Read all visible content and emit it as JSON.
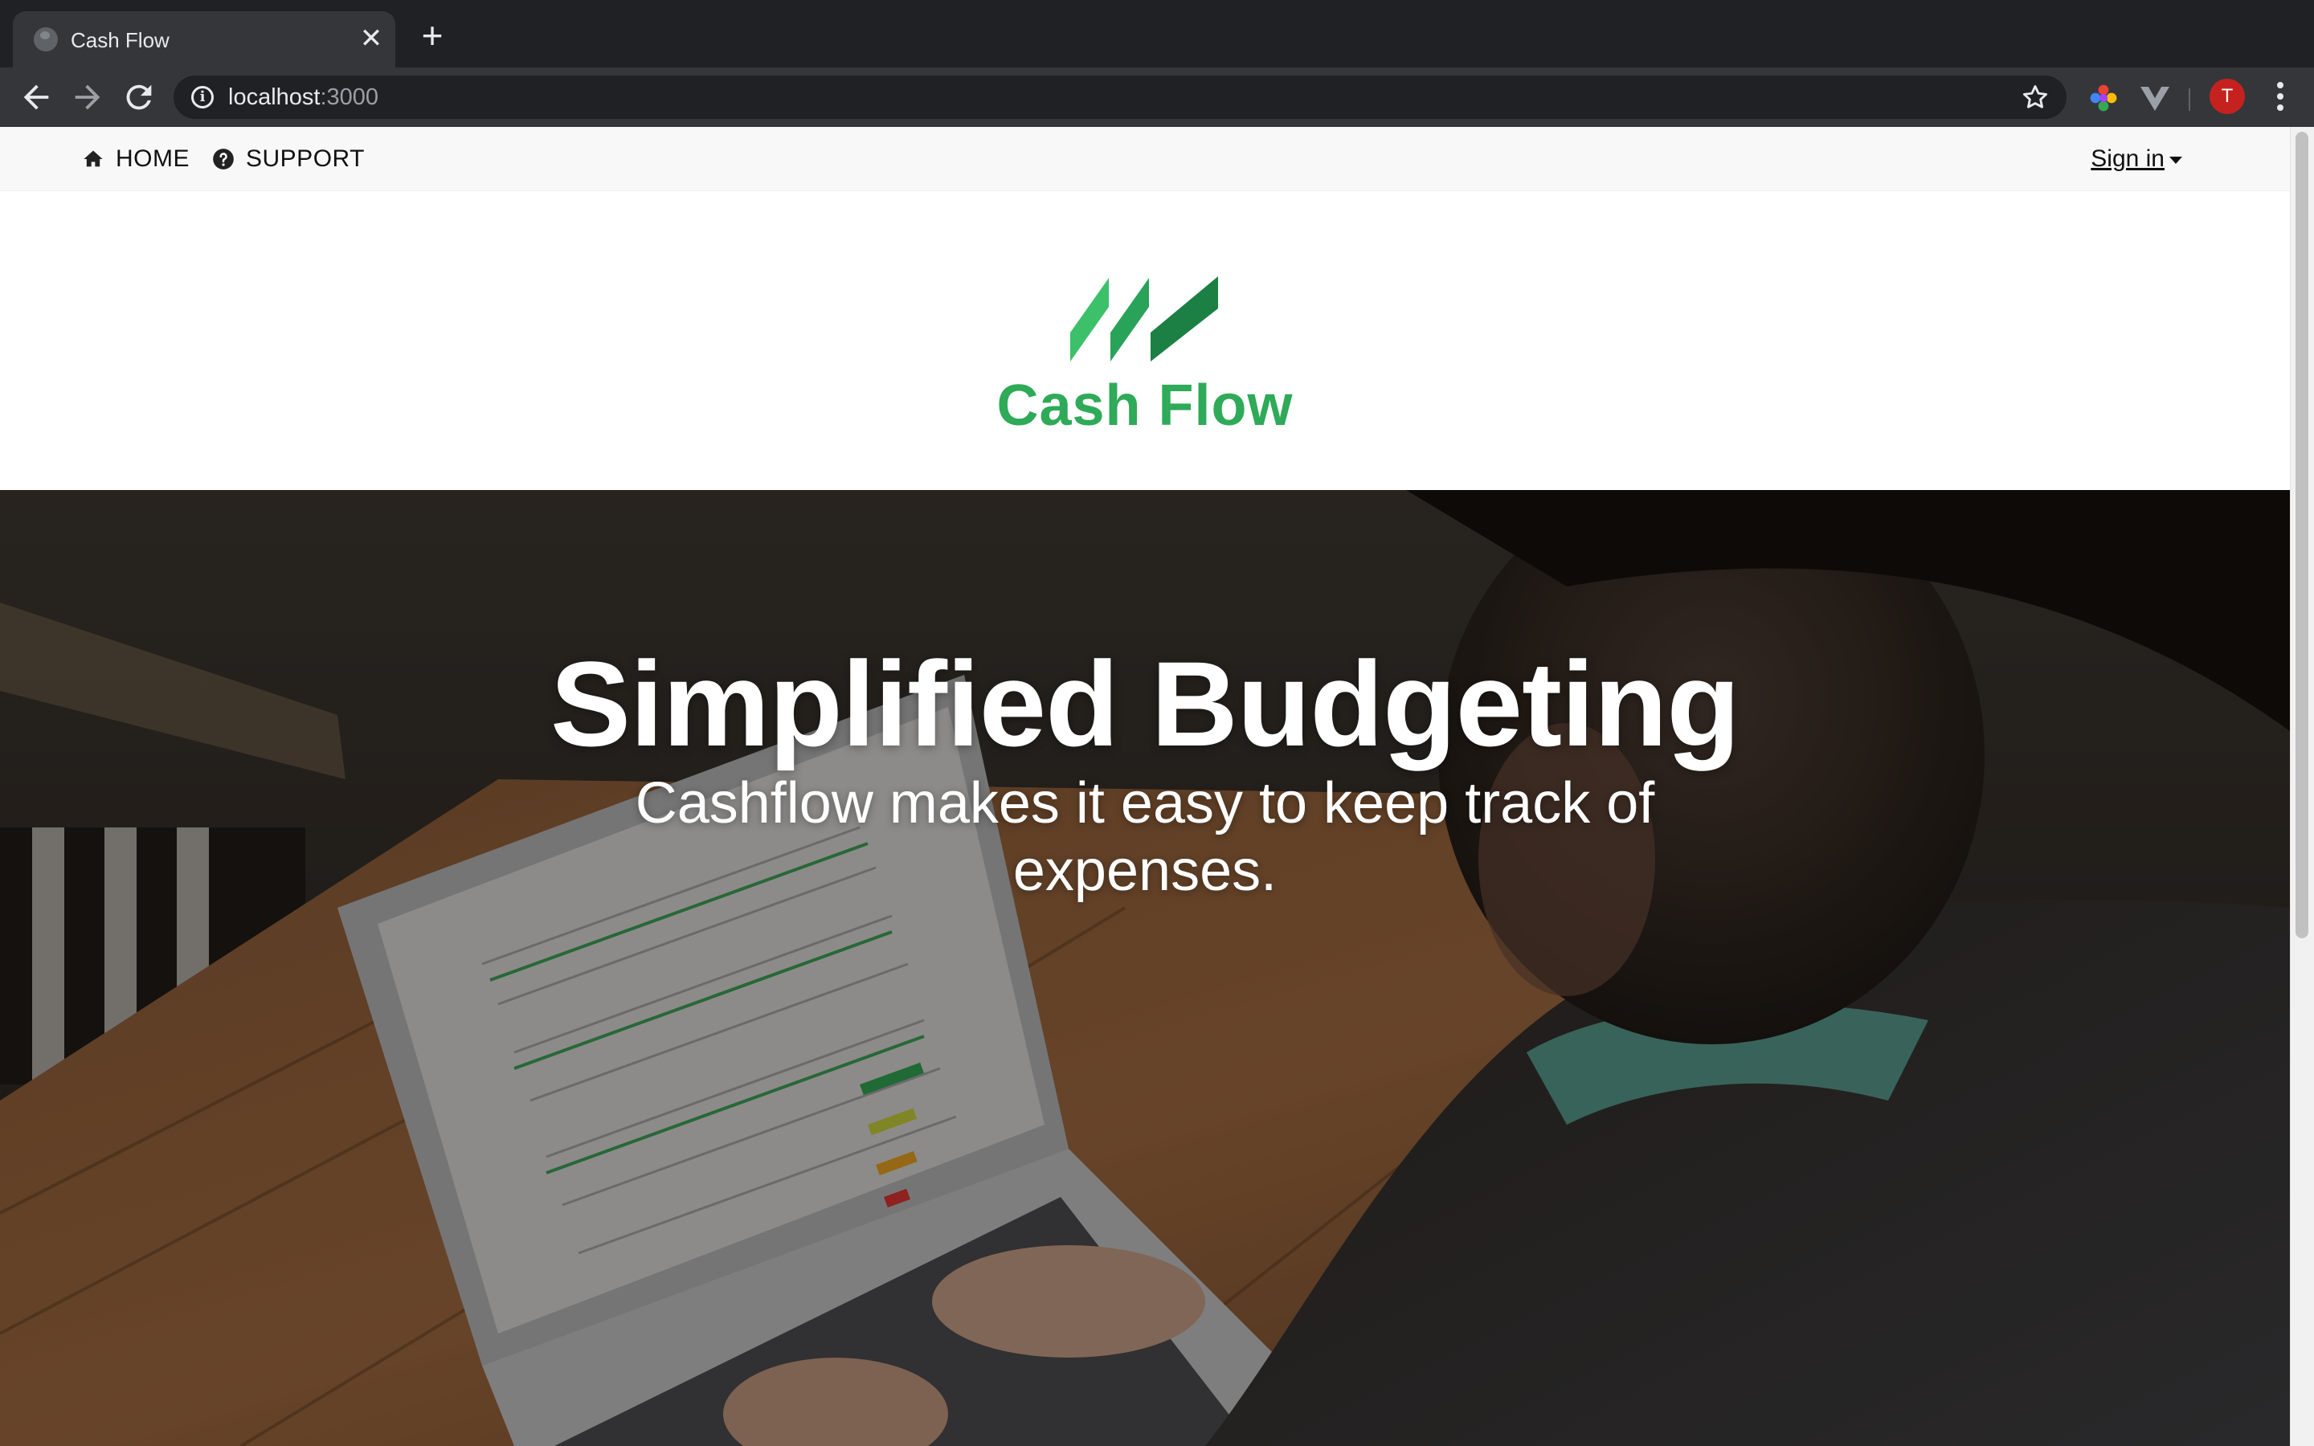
{
  "browser": {
    "tab": {
      "title": "Cash Flow",
      "close_glyph": "✕",
      "favicon": "globe-icon"
    },
    "new_tab_glyph": "+",
    "address": {
      "host": "localhost",
      "port": ":3000"
    },
    "avatar_initial": "T",
    "colors": {
      "frame": "#202124",
      "toolbar": "#35363a",
      "avatar": "#c5221f"
    }
  },
  "site_nav": {
    "home": {
      "label": "HOME",
      "icon": "home-icon"
    },
    "support": {
      "label": "SUPPORT",
      "icon": "question-circle-icon"
    },
    "signin": {
      "label": "Sign in"
    }
  },
  "logo": {
    "text": "Cash Flow",
    "color": "#2eaa58"
  },
  "hero": {
    "title": "Simplified Budgeting",
    "subtitle": "Cashflow makes it easy to keep track of expenses."
  }
}
